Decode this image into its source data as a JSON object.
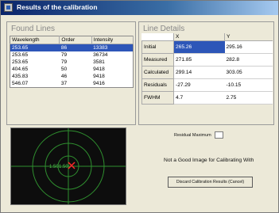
{
  "window": {
    "title": "Results of the calibration",
    "icon": "app-icon"
  },
  "found_lines": {
    "title": "Found Lines",
    "columns": [
      "Wavelength",
      "Order",
      "Intensity"
    ],
    "rows": [
      [
        "253.65",
        "86",
        "13383"
      ],
      [
        "253.65",
        "79",
        "36734"
      ],
      [
        "253.65",
        "79",
        "3581"
      ],
      [
        "404.65",
        "50",
        "9418"
      ],
      [
        "435.83",
        "46",
        "9418"
      ],
      [
        "546.07",
        "37",
        "9416"
      ]
    ]
  },
  "line_details": {
    "title": "Line Details",
    "columns": [
      "X",
      "Y"
    ],
    "rows": [
      {
        "label": "Initial",
        "x": "265.26",
        "y": "295.16"
      },
      {
        "label": "Measured",
        "x": "271.85",
        "y": "282.8"
      },
      {
        "label": "Calculated",
        "x": "299.14",
        "y": "303.05"
      },
      {
        "label": "Residuals",
        "x": "-27.29",
        "y": "-10.15"
      },
      {
        "label": "FWHM",
        "x": "4.7",
        "y": "2.75"
      }
    ]
  },
  "residual": {
    "label": "Residual Maximum",
    "value": ""
  },
  "status_message": "Not a Good Image for Calibrating With",
  "discard_button": "Discard Calibration Results (Cancel)",
  "target": {
    "labels": [
      "1.50",
      "1.50"
    ],
    "ring_color": "#2f8f2f",
    "marker_color": "#ff2a2a"
  },
  "colors": {
    "selection": "#2d56b8",
    "title_bar": "#0a246a"
  }
}
